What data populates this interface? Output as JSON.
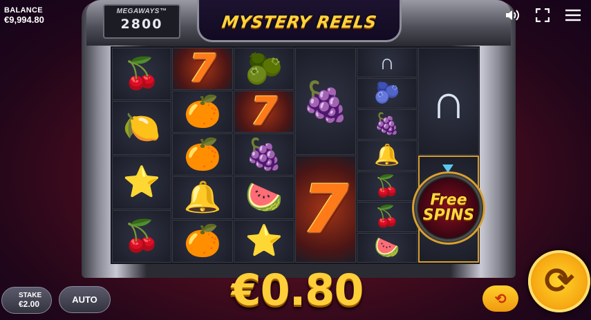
{
  "balance": {
    "label": "BALANCE",
    "value": "€9,994.80"
  },
  "header": {
    "megaways_label": "MEGAWAYS™",
    "megaways_count": "2800",
    "logo": "MYSTERY REELS"
  },
  "icons": {
    "sound": "speaker-icon",
    "fullscreen": "fullscreen-icon",
    "menu": "hamburger-menu-icon"
  },
  "reels": [
    [
      "cherry",
      "lemon",
      "star",
      "cherry"
    ],
    [
      "seven",
      "orange",
      "orange",
      "bell",
      "orange"
    ],
    [
      "plum",
      "seven",
      "grapes",
      "watermelon",
      "star"
    ],
    [
      "grapes",
      "seven"
    ],
    [
      "horseshoe",
      "plum",
      "grapes",
      "bell",
      "cherry",
      "cherry",
      "watermelon"
    ],
    [
      "horseshoe",
      "free-spins"
    ]
  ],
  "free_spins": {
    "line1": "Free",
    "line2": "SPINS"
  },
  "win_amount": "€0.80",
  "controls": {
    "stake_label": "STAKE",
    "stake_value": "€2.00",
    "auto_label": "AUTO",
    "turbo_icon": "turbo-icon",
    "spin_icon": "spin-icon"
  },
  "colors": {
    "accent": "#ffcf3a",
    "spin": "#f6a812",
    "background": "#4a0d1e"
  }
}
